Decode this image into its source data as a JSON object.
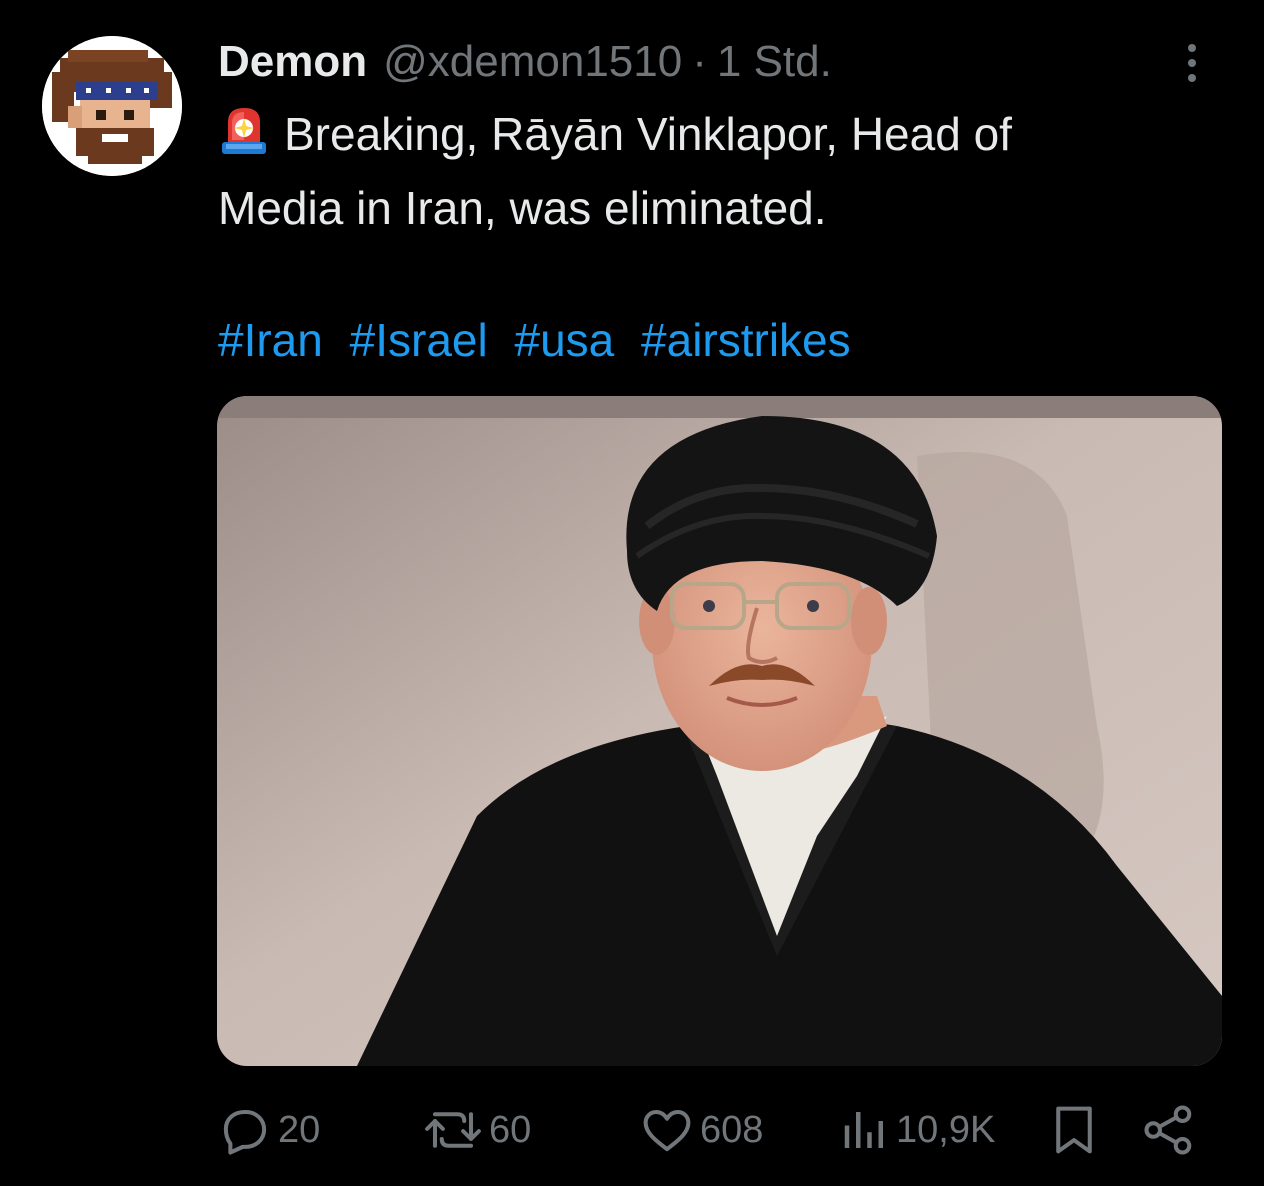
{
  "author": {
    "display_name": "Demon",
    "handle": "@xdemon1510",
    "separator": "·",
    "timestamp": "1 Std.",
    "avatar_icon": "pixel-art-pirate-avatar"
  },
  "post": {
    "emoji_icon": "police-siren-icon",
    "text_line1": "Breaking, Rāyān Vinklapor, Head of",
    "text_line2": "Media in Iran, was eliminated.",
    "hashtags": [
      "#Iran",
      "#Israel",
      "#usa",
      "#airstrikes"
    ],
    "media_description": "photo"
  },
  "actions": {
    "replies": "20",
    "reposts": "60",
    "likes": "608",
    "views": "10,9K"
  },
  "colors": {
    "background": "#000000",
    "text": "#e7e9ea",
    "muted": "#71767b",
    "link": "#1d9bf0"
  }
}
